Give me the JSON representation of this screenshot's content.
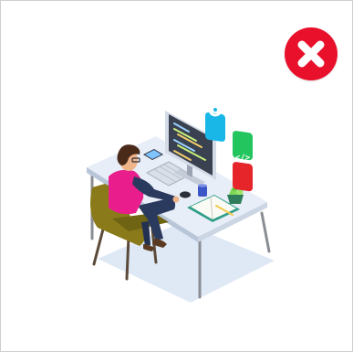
{
  "dialog": {
    "close_icon": "close-x-icon",
    "close_color": "#e8102b"
  },
  "illustration": {
    "subject": "developer-at-desk",
    "icons": [
      "gear-icon",
      "code-braces-icon",
      "code-tag-icon"
    ],
    "accent_colors": {
      "shirt": "#e91e8c",
      "chair": "#8a7a1a",
      "desk": "#e6edf7",
      "monitor_screen": "#3a4150",
      "badge_cyan": "#19b7e8",
      "badge_green": "#22c55e",
      "badge_red": "#e5252a"
    }
  }
}
